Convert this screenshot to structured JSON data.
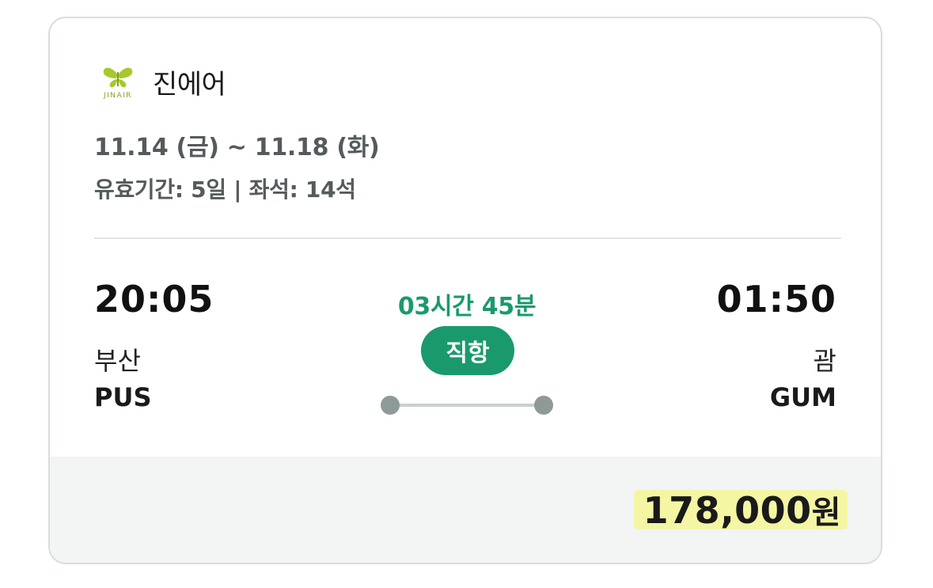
{
  "airline": {
    "name": "진에어",
    "logo_text": "JINAIR"
  },
  "schedule": {
    "dates": "11.14 (금) ~ 11.18 (화)",
    "validity": "유효기간: 5일 | 좌석: 14석"
  },
  "flight": {
    "departure": {
      "time": "20:05",
      "city": "부산",
      "code": "PUS"
    },
    "arrival": {
      "time": "01:50",
      "city": "괌",
      "code": "GUM"
    },
    "duration": "03시간 45분",
    "type": "직항"
  },
  "price": {
    "amount": "178,000",
    "unit": "원"
  },
  "colors": {
    "accent": "#1a9a6c",
    "logo_green": "#a8c92b",
    "price_highlight": "#f4f6a3"
  }
}
